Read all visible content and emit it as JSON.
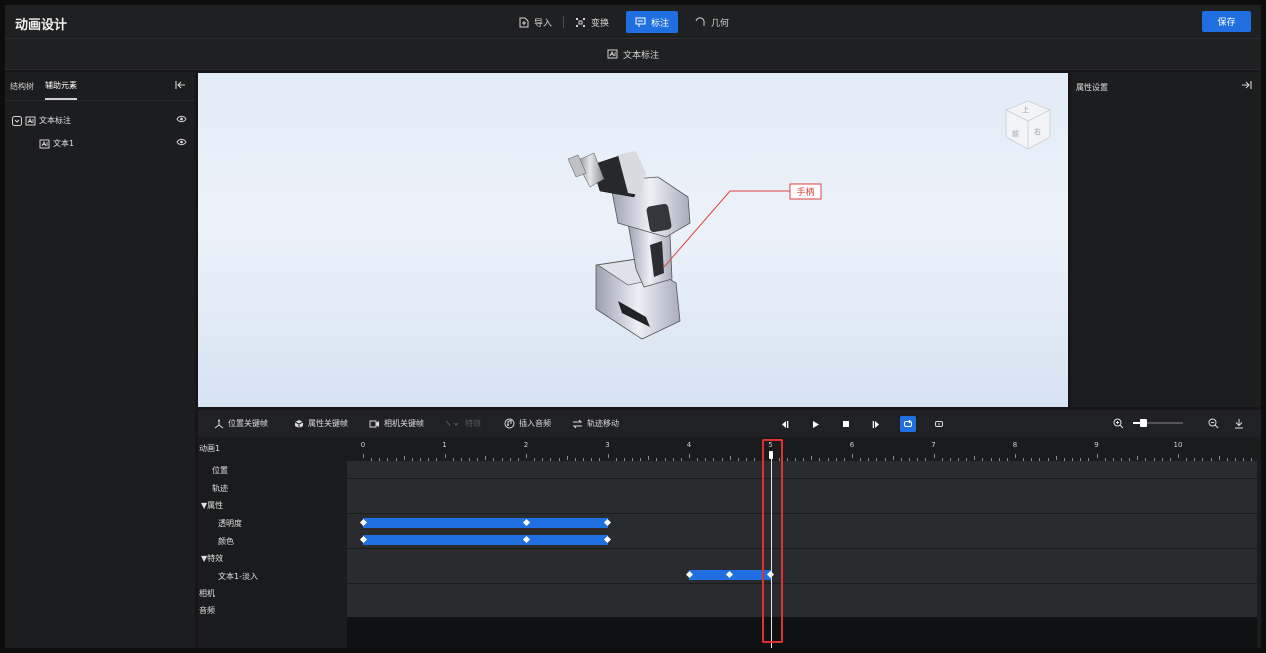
{
  "app": {
    "title": "动画设计",
    "save_label": "保存"
  },
  "toolbar": {
    "import_label": "导入",
    "transform_label": "变换",
    "annotate_label": "标注",
    "geometry_label": "几何"
  },
  "subbar": {
    "label": "文本标注"
  },
  "left_panel": {
    "tabs": [
      {
        "label": "结构树"
      },
      {
        "label": "辅助元素"
      }
    ],
    "tree": [
      {
        "label": "文本标注"
      },
      {
        "label": "文本1"
      }
    ]
  },
  "viewport": {
    "annotation_text": "手柄",
    "viewcube": {
      "top": "上",
      "front": "前",
      "right": "右"
    }
  },
  "right_panel": {
    "title": "属性设置"
  },
  "timeline": {
    "toolbar": {
      "position_keyframe": "位置关键帧",
      "property_keyframe": "属性关键帧",
      "camera_keyframe": "相机关键帧",
      "effect": "特效",
      "insert_audio": "插入音频",
      "track_move": "轨迹移动"
    },
    "animation_name": "动画1",
    "ruler_labels": [
      "0",
      "1",
      "2",
      "3",
      "4",
      "5",
      "6",
      "7",
      "8",
      "9",
      "10",
      "1"
    ],
    "rows": {
      "position": "位置",
      "trajectory": "轨迹",
      "properties": "▼属性",
      "opacity": "透明度",
      "color": "颜色",
      "effects": "▼特效",
      "fade_in": "文本1-淡入",
      "camera": "相机",
      "audio": "音频"
    },
    "keyframes": {
      "opacity": [
        0,
        2,
        3
      ],
      "color": [
        0,
        2,
        3
      ],
      "fade_in": [
        4,
        4.5,
        5
      ]
    },
    "playhead_time": 5,
    "zoom_level": 0.2
  },
  "colors": {
    "accent": "#1f6fe0",
    "highlight": "#e03030",
    "annotation": "#e04040"
  }
}
